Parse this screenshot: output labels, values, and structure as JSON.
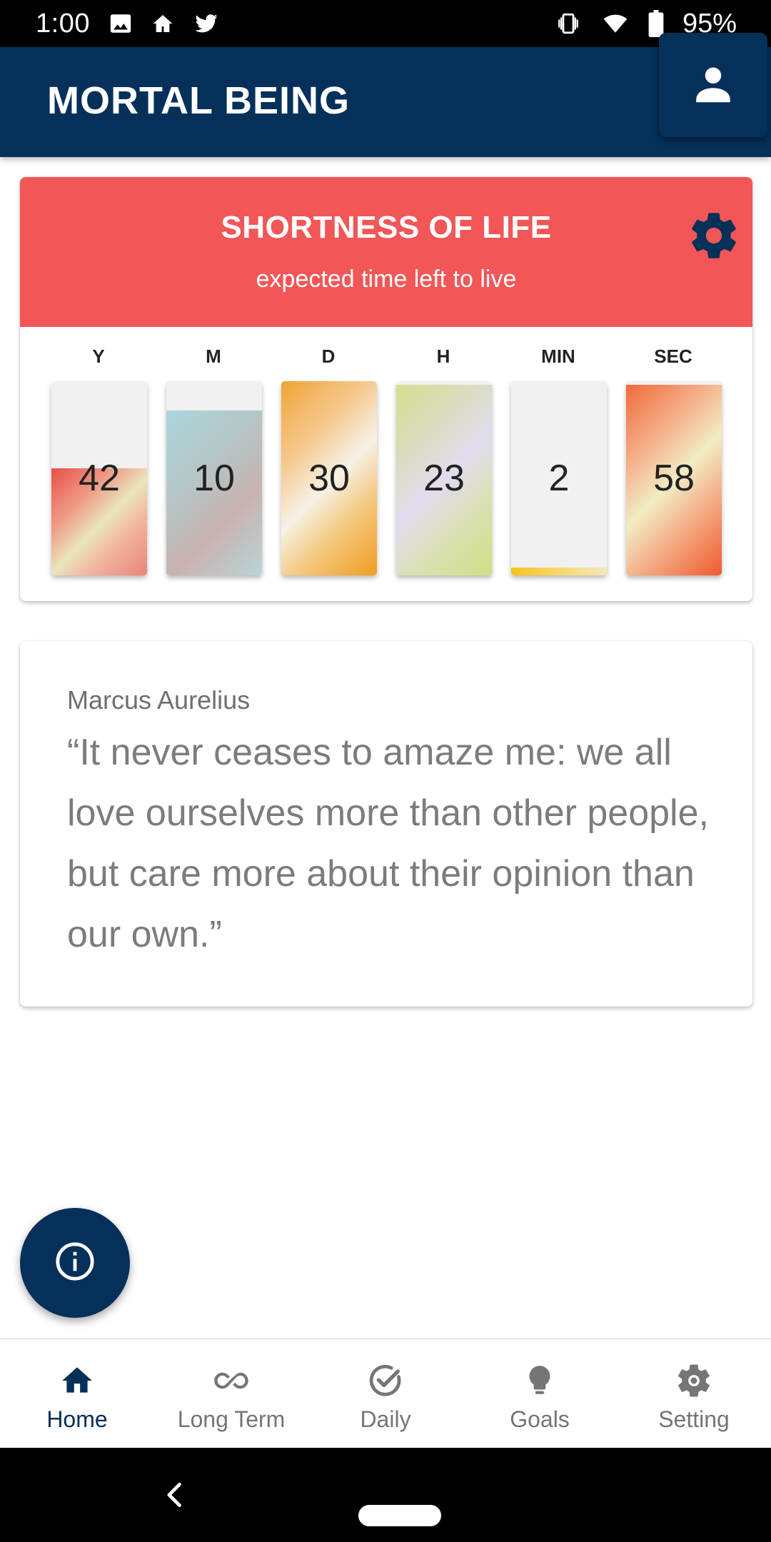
{
  "status_bar": {
    "time": "1:00",
    "battery": "95%",
    "icons": [
      "image-icon",
      "home-icon",
      "twitter-icon",
      "vibrate-icon",
      "wifi-icon",
      "battery-icon"
    ]
  },
  "app_bar": {
    "title": "MORTAL BEING",
    "profile_icon": "person-icon"
  },
  "life_card": {
    "title": "SHORTNESS OF LIFE",
    "subtitle": "expected time left to live",
    "header_color": "#f25657",
    "settings_icon": "gear-icon",
    "units": [
      {
        "label": "Y",
        "value": "42",
        "fill": 0.55
      },
      {
        "label": "M",
        "value": "10",
        "fill": 0.85
      },
      {
        "label": "D",
        "value": "30",
        "fill": 1.0
      },
      {
        "label": "H",
        "value": "23",
        "fill": 0.98
      },
      {
        "label": "MIN",
        "value": "2",
        "fill": 0.04
      },
      {
        "label": "SEC",
        "value": "58",
        "fill": 0.98
      }
    ]
  },
  "quote": {
    "author": "Marcus Aurelius",
    "text": "“It never ceases to amaze me: we all love ourselves more than other people, but care more about their opinion than our own.”"
  },
  "fab": {
    "icon": "info-icon"
  },
  "bottom_nav": {
    "items": [
      {
        "label": "Home",
        "icon": "home-icon",
        "active": true
      },
      {
        "label": "Long Term",
        "icon": "infinity-icon",
        "active": false
      },
      {
        "label": "Daily",
        "icon": "check-circle-icon",
        "active": false
      },
      {
        "label": "Goals",
        "icon": "lightbulb-icon",
        "active": false
      },
      {
        "label": "Setting",
        "icon": "settings-gear-icon",
        "active": false
      }
    ]
  },
  "colors": {
    "primary": "#05305a",
    "accent": "#f25657"
  }
}
